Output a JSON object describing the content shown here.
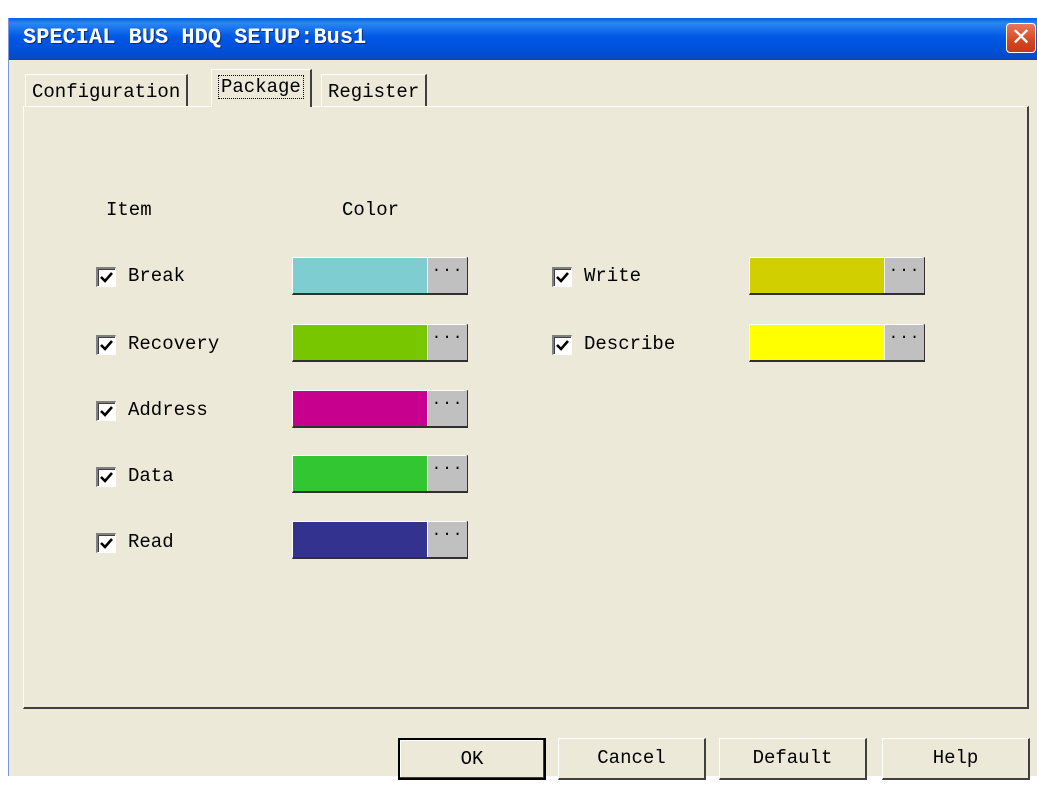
{
  "window": {
    "title": "SPECIAL BUS HDQ SETUP:Bus1",
    "close_glyph": "✕",
    "close_icon": "close-icon"
  },
  "tabs": [
    {
      "label": "Configuration",
      "active": false
    },
    {
      "label": "Package",
      "active": true
    },
    {
      "label": "Register",
      "active": false
    }
  ],
  "headers": {
    "item": "Item",
    "color": "Color"
  },
  "items": [
    {
      "label": "Break",
      "checked": true,
      "color": "#7ecdd0"
    },
    {
      "label": "Recovery",
      "checked": true,
      "color": "#77c600"
    },
    {
      "label": "Address",
      "checked": true,
      "color": "#c8008e"
    },
    {
      "label": "Data",
      "checked": true,
      "color": "#33c633"
    },
    {
      "label": "Read",
      "checked": true,
      "color": "#33338f"
    },
    {
      "label": "Write",
      "checked": true,
      "color": "#d2cf00"
    },
    {
      "label": "Describe",
      "checked": true,
      "color": "#ffff00"
    }
  ],
  "picker_label": "···",
  "buttons": {
    "ok": "OK",
    "cancel": "Cancel",
    "default": "Default",
    "help": "Help"
  }
}
